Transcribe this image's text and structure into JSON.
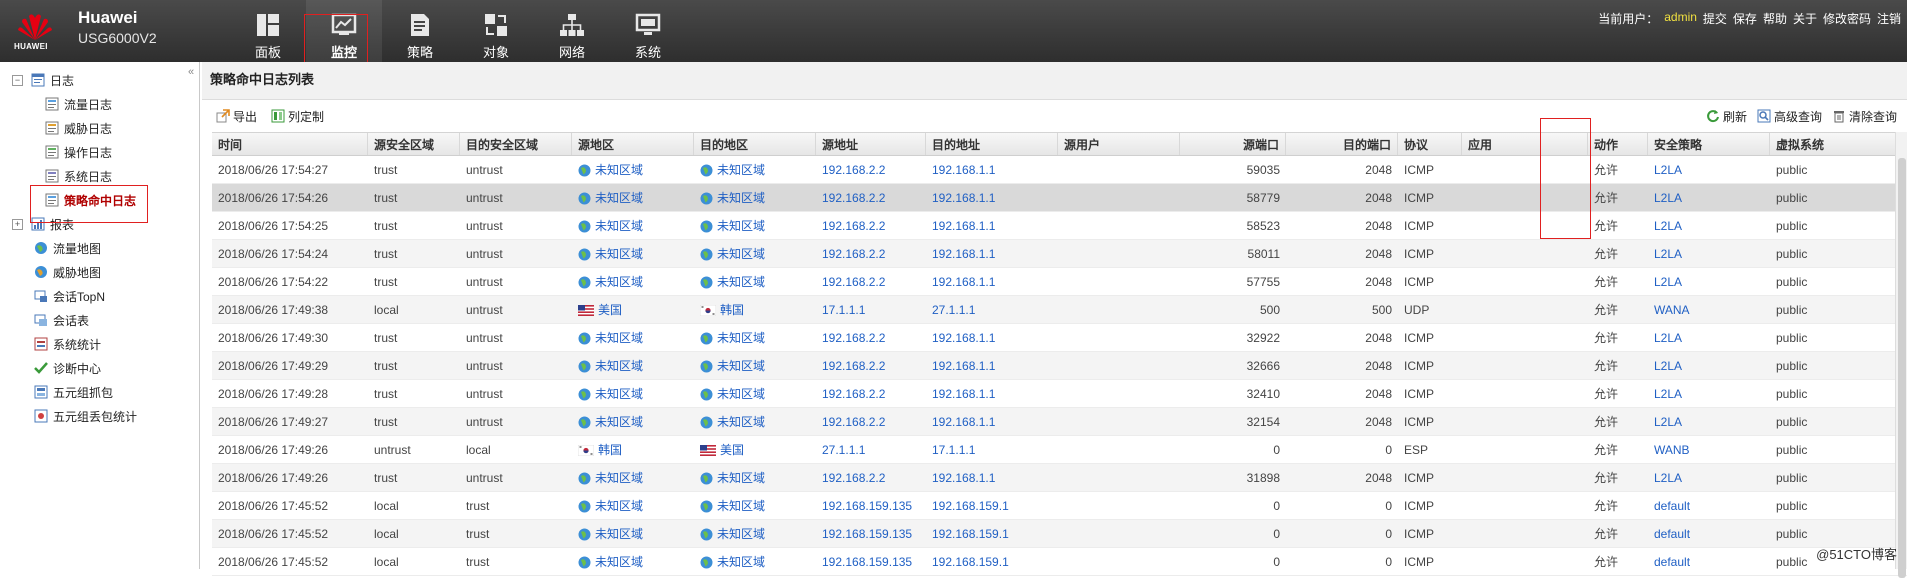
{
  "header": {
    "logo_text": "HUAWEI",
    "brand_name": "Huawei",
    "brand_model": "USG6000V2",
    "nav": [
      {
        "label": "面板",
        "icon": "dashboard-icon"
      },
      {
        "label": "监控",
        "icon": "monitor-icon",
        "active": true
      },
      {
        "label": "策略",
        "icon": "policy-icon"
      },
      {
        "label": "对象",
        "icon": "object-icon"
      },
      {
        "label": "网络",
        "icon": "network-icon"
      },
      {
        "label": "系统",
        "icon": "system-icon"
      }
    ],
    "user_label": "当前用户：",
    "user_name": "admin",
    "links": [
      "提交",
      "保存",
      "帮助",
      "关于",
      "修改密码",
      "注销"
    ]
  },
  "sidebar": {
    "collapse": "«",
    "log_group": "日志",
    "log_items": [
      "流量日志",
      "威胁日志",
      "操作日志",
      "系统日志",
      "策略命中日志"
    ],
    "report": "报表",
    "items": [
      "流量地图",
      "威胁地图",
      "会话TopN",
      "会话表",
      "系统统计",
      "诊断中心",
      "五元组抓包",
      "五元组丢包统计"
    ],
    "expand_open": "−",
    "expand_closed": "+"
  },
  "main": {
    "title": "策略命中日志列表",
    "toolbar": {
      "export": "导出",
      "customize": "列定制",
      "refresh": "刷新",
      "advanced": "高级查询",
      "clear": "清除查询"
    },
    "columns": [
      "时间",
      "源安全区域",
      "目的安全区域",
      "源地区",
      "目的地区",
      "源地址",
      "目的地址",
      "源用户",
      "源端口",
      "目的端口",
      "协议",
      "应用",
      "动作",
      "安全策略",
      "虚拟系统"
    ],
    "rows": [
      [
        "2018/06/26 17:54:27",
        "trust",
        "untrust",
        "未知区域",
        "未知区域",
        "192.168.2.2",
        "192.168.1.1",
        "",
        "59035",
        "2048",
        "ICMP",
        "",
        "允许",
        "L2LA",
        "public"
      ],
      [
        "2018/06/26 17:54:26",
        "trust",
        "untrust",
        "未知区域",
        "未知区域",
        "192.168.2.2",
        "192.168.1.1",
        "",
        "58779",
        "2048",
        "ICMP",
        "",
        "允许",
        "L2LA",
        "public"
      ],
      [
        "2018/06/26 17:54:25",
        "trust",
        "untrust",
        "未知区域",
        "未知区域",
        "192.168.2.2",
        "192.168.1.1",
        "",
        "58523",
        "2048",
        "ICMP",
        "",
        "允许",
        "L2LA",
        "public"
      ],
      [
        "2018/06/26 17:54:24",
        "trust",
        "untrust",
        "未知区域",
        "未知区域",
        "192.168.2.2",
        "192.168.1.1",
        "",
        "58011",
        "2048",
        "ICMP",
        "",
        "允许",
        "L2LA",
        "public"
      ],
      [
        "2018/06/26 17:54:22",
        "trust",
        "untrust",
        "未知区域",
        "未知区域",
        "192.168.2.2",
        "192.168.1.1",
        "",
        "57755",
        "2048",
        "ICMP",
        "",
        "允许",
        "L2LA",
        "public"
      ],
      [
        "2018/06/26 17:49:38",
        "local",
        "untrust",
        "美国",
        "韩国",
        "17.1.1.1",
        "27.1.1.1",
        "",
        "500",
        "500",
        "UDP",
        "",
        "允许",
        "WANA",
        "public"
      ],
      [
        "2018/06/26 17:49:30",
        "trust",
        "untrust",
        "未知区域",
        "未知区域",
        "192.168.2.2",
        "192.168.1.1",
        "",
        "32922",
        "2048",
        "ICMP",
        "",
        "允许",
        "L2LA",
        "public"
      ],
      [
        "2018/06/26 17:49:29",
        "trust",
        "untrust",
        "未知区域",
        "未知区域",
        "192.168.2.2",
        "192.168.1.1",
        "",
        "32666",
        "2048",
        "ICMP",
        "",
        "允许",
        "L2LA",
        "public"
      ],
      [
        "2018/06/26 17:49:28",
        "trust",
        "untrust",
        "未知区域",
        "未知区域",
        "192.168.2.2",
        "192.168.1.1",
        "",
        "32410",
        "2048",
        "ICMP",
        "",
        "允许",
        "L2LA",
        "public"
      ],
      [
        "2018/06/26 17:49:27",
        "trust",
        "untrust",
        "未知区域",
        "未知区域",
        "192.168.2.2",
        "192.168.1.1",
        "",
        "32154",
        "2048",
        "ICMP",
        "",
        "允许",
        "L2LA",
        "public"
      ],
      [
        "2018/06/26 17:49:26",
        "untrust",
        "local",
        "韩国",
        "美国",
        "27.1.1.1",
        "17.1.1.1",
        "",
        "0",
        "0",
        "ESP",
        "",
        "允许",
        "WANB",
        "public"
      ],
      [
        "2018/06/26 17:49:26",
        "trust",
        "untrust",
        "未知区域",
        "未知区域",
        "192.168.2.2",
        "192.168.1.1",
        "",
        "31898",
        "2048",
        "ICMP",
        "",
        "允许",
        "L2LA",
        "public"
      ],
      [
        "2018/06/26 17:45:52",
        "local",
        "trust",
        "未知区域",
        "未知区域",
        "192.168.159.135",
        "192.168.159.1",
        "",
        "0",
        "0",
        "ICMP",
        "",
        "允许",
        "default",
        "public"
      ],
      [
        "2018/06/26 17:45:52",
        "local",
        "trust",
        "未知区域",
        "未知区域",
        "192.168.159.135",
        "192.168.159.1",
        "",
        "0",
        "0",
        "ICMP",
        "",
        "允许",
        "default",
        "public"
      ],
      [
        "2018/06/26 17:45:52",
        "local",
        "trust",
        "未知区域",
        "未知区域",
        "192.168.159.135",
        "192.168.159.1",
        "",
        "0",
        "0",
        "ICMP",
        "",
        "允许",
        "default",
        "public"
      ]
    ]
  },
  "watermark": "@51CTO博客",
  "colors": {
    "accent_red": "#e02020",
    "link_blue": "#1f5fc4",
    "header_bg": "#3a3a3a",
    "user_yellow": "#f0e040"
  }
}
